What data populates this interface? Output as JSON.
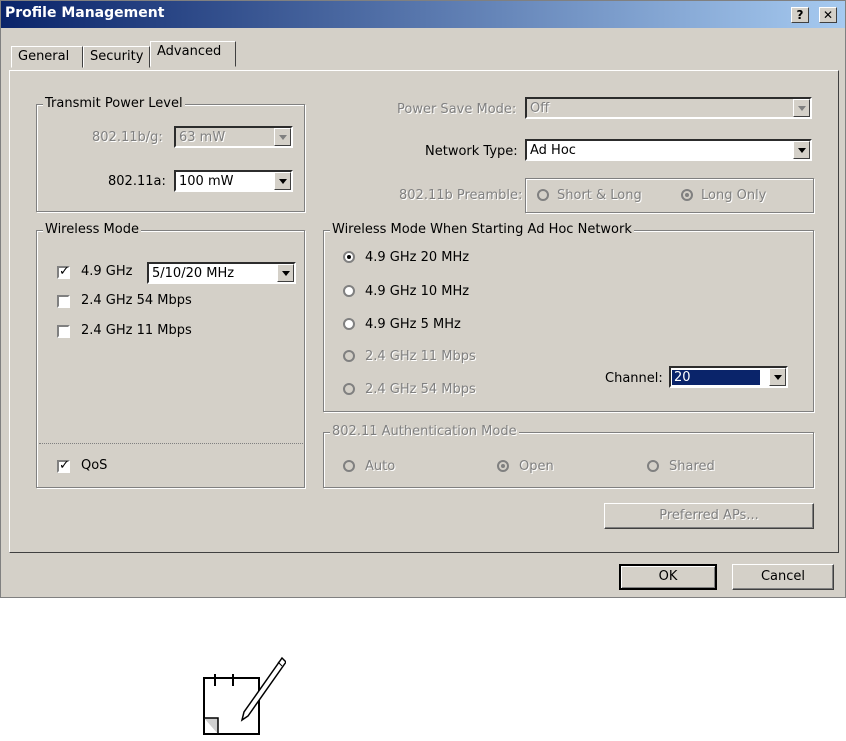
{
  "window": {
    "title": "Profile Management",
    "help_label": "?",
    "close_label": "✕"
  },
  "tabs": [
    {
      "label": "General"
    },
    {
      "label": "Security"
    },
    {
      "label": "Advanced"
    }
  ],
  "transmit_power": {
    "legend": "Transmit Power Level",
    "bg_label": "802.11b/g:",
    "bg_value": "63 mW",
    "a_label": "802.11a:",
    "a_value": "100 mW"
  },
  "power_save": {
    "label": "Power Save Mode:",
    "value": "Off"
  },
  "network_type": {
    "label": "Network Type:",
    "value": "Ad Hoc"
  },
  "preamble": {
    "label": "802.11b Preamble:",
    "short_long": "Short & Long",
    "long_only": "Long Only"
  },
  "wireless_mode": {
    "legend": "Wireless Mode",
    "ghz49_label": "4.9 GHz",
    "ghz49_checked": true,
    "ghz49_bandwidth": "5/10/20 MHz",
    "ghz24_54_label": "2.4 GHz 54 Mbps",
    "ghz24_11_label": "2.4 GHz 11 Mbps",
    "qos_label": "QoS",
    "qos_checked": true
  },
  "adhoc_mode": {
    "legend": "Wireless Mode When Starting Ad Hoc Network",
    "options": [
      "4.9 GHz 20 MHz",
      "4.9 GHz 10 MHz",
      "4.9 GHz 5 MHz",
      "2.4 GHz 11 Mbps",
      "2.4 GHz 54 Mbps"
    ],
    "selected": "4.9 GHz 20 MHz",
    "channel_label": "Channel:",
    "channel_value": "20"
  },
  "auth_mode": {
    "legend": "802.11 Authentication Mode",
    "auto": "Auto",
    "open": "Open",
    "shared": "Shared"
  },
  "buttons": {
    "preferred_aps": "Preferred APs...",
    "ok": "OK",
    "cancel": "Cancel"
  },
  "icons": {
    "note": "note-pencil-icon"
  }
}
